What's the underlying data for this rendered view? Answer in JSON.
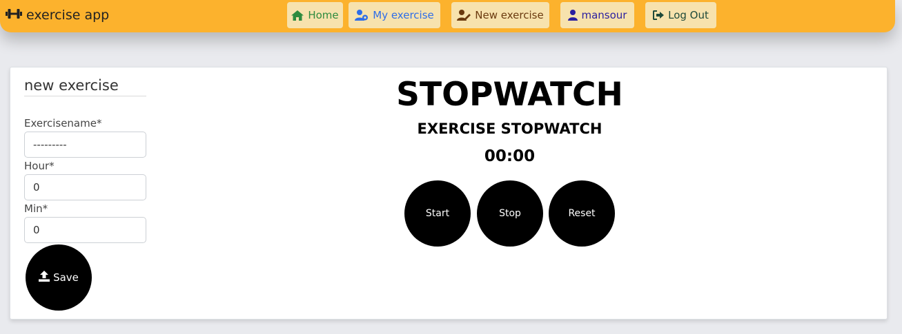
{
  "navbar": {
    "brand": "exercise app",
    "items": [
      {
        "label": "Home",
        "icon": "home-icon",
        "color": "#2e8b3e"
      },
      {
        "label": "My exercise",
        "icon": "user-cog-icon",
        "color": "#2f6ee8"
      },
      {
        "label": "New exercise",
        "icon": "user-edit-icon",
        "color": "#6b3a0f"
      },
      {
        "label": "mansour",
        "icon": "user-icon",
        "color": "#2b1fa0"
      },
      {
        "label": "Log Out",
        "icon": "sign-out-icon",
        "color": "#1f4a3a"
      }
    ]
  },
  "form": {
    "title": "new exercise",
    "exercise_label": "Exercisename*",
    "exercise_value": "---------",
    "hour_label": "Hour*",
    "hour_value": "0",
    "min_label": "Min*",
    "min_value": "0",
    "save_label": "Save"
  },
  "stopwatch": {
    "title": "STOPWATCH",
    "subtitle": "EXERCISE STOPWATCH",
    "time": "00:00",
    "start_label": "Start",
    "stop_label": "Stop",
    "reset_label": "Reset"
  }
}
